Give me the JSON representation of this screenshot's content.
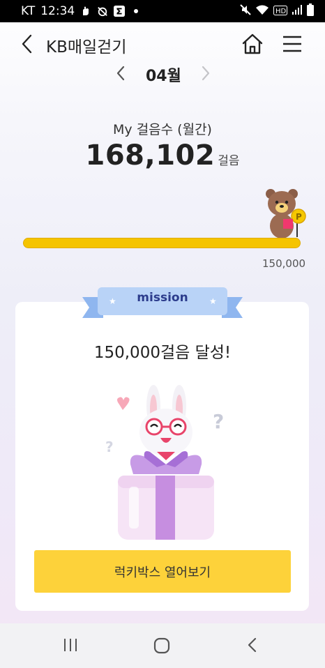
{
  "status_bar": {
    "carrier": "KT",
    "time": "12:34",
    "left_icons": [
      "hand-icon",
      "notification-off-icon",
      "sigma-icon",
      "dot-icon"
    ],
    "right_icons": [
      "mute-icon",
      "wifi-icon",
      "hd-icon",
      "signal-icon",
      "battery-icon"
    ]
  },
  "header": {
    "title": "KB매일걷기",
    "back_icon": "chevron-left-icon",
    "home_icon": "home-icon",
    "menu_icon": "hamburger-menu-icon"
  },
  "month_nav": {
    "label": "04월"
  },
  "steps": {
    "title": "My 걸음수 (월간)",
    "value": "168,102",
    "unit": "걸음"
  },
  "progress": {
    "fraction": 1.0,
    "goal_label": "150,000",
    "fill_color": "#f5c400"
  },
  "mission": {
    "ribbon_label": "mission",
    "headline": "150,000걸음 달성!",
    "cta_label": "럭키박스 열어보기",
    "cta_color": "#fdd23a"
  },
  "system_nav": {
    "recent_icon": "recent-apps-icon",
    "home_icon": "home-circle-icon",
    "back_icon": "back-icon"
  }
}
